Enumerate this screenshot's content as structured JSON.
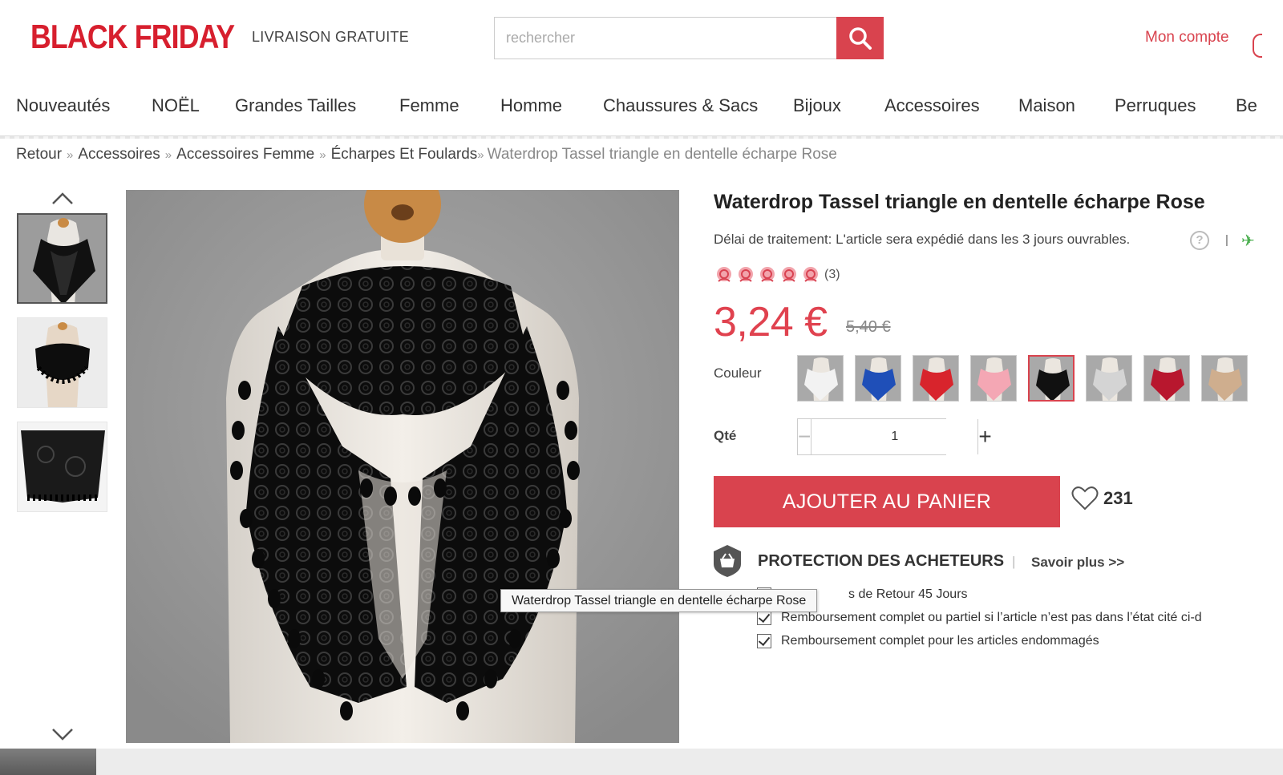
{
  "header": {
    "logo": "BLACK FRIDAY",
    "shipping": "LIVRAISON GRATUITE",
    "search_placeholder": "rechercher",
    "account": "Mon compte"
  },
  "nav": {
    "items": [
      "Nouveautés",
      "NOËL",
      "Grandes Tailles",
      "Femme",
      "Homme",
      "Chaussures & Sacs",
      "Bijoux",
      "Accessoires",
      "Maison",
      "Perruques",
      "Be"
    ]
  },
  "breadcrumb": {
    "items": [
      "Retour",
      "Accessoires",
      "Accessoires Femme",
      "Écharpes Et Foulards"
    ],
    "separator": "»",
    "current": "Waterdrop Tassel triangle en dentelle écharpe Rose"
  },
  "product": {
    "title": "Waterdrop Tassel triangle en dentelle écharpe Rose",
    "delay": "Délai de traitement: L'article sera expédié dans les 3 jours ouvrables.",
    "help": "?",
    "rating": 5,
    "reviews": "(3)",
    "price": "3,24 €",
    "old_price": "5,40 €",
    "color_label": "Couleur",
    "colors": [
      {
        "name": "white",
        "hex": "#f2f2f2"
      },
      {
        "name": "blue",
        "hex": "#1f4fb8"
      },
      {
        "name": "red",
        "hex": "#d8242c"
      },
      {
        "name": "pink",
        "hex": "#f4a7b4"
      },
      {
        "name": "black",
        "hex": "#111111",
        "selected": true
      },
      {
        "name": "light-gray",
        "hex": "#d4d4d4"
      },
      {
        "name": "wine-red",
        "hex": "#b8172e"
      },
      {
        "name": "beige",
        "hex": "#cfae8e"
      }
    ],
    "qty_label": "Qté",
    "qty_value": "1",
    "add_to_cart": "AJOUTER AU PANIER",
    "wish_count": "231"
  },
  "protection": {
    "title": "PROTECTION DES ACHETEURS",
    "more": "Savoir plus >>",
    "items": [
      "s de Retour 45 Jours",
      "Remboursement complet ou partiel si l’article n’est pas dans l’état cité ci-d",
      "Remboursement complet pour les articles endommagés"
    ]
  },
  "tooltip": "Waterdrop Tassel triangle en dentelle écharpe Rose",
  "colors": {
    "accent": "#d9434e",
    "logo": "#d71f2e",
    "price": "#e0424f"
  }
}
